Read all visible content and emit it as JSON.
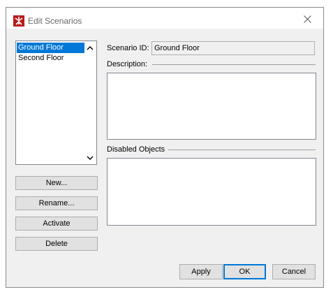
{
  "window": {
    "title": "Edit Scenarios",
    "icon": "app-logo-icon",
    "accent": "#b81c1c"
  },
  "scenario_list": {
    "items": [
      {
        "label": "Ground Floor",
        "selected": true
      },
      {
        "label": "Second Floor",
        "selected": false
      }
    ]
  },
  "buttons": {
    "new": "New...",
    "rename": "Rename...",
    "activate": "Activate",
    "delete": "Delete",
    "apply": "Apply",
    "ok": "OK",
    "cancel": "Cancel"
  },
  "details": {
    "scenario_id_label": "Scenario ID:",
    "scenario_id_value": "Ground Floor",
    "description_label": "Description:",
    "description_value": "",
    "disabled_objects_label": "Disabled Objects",
    "disabled_objects_value": ""
  },
  "colors": {
    "selection": "#0078d7",
    "default_button_border": "#0078d7"
  }
}
